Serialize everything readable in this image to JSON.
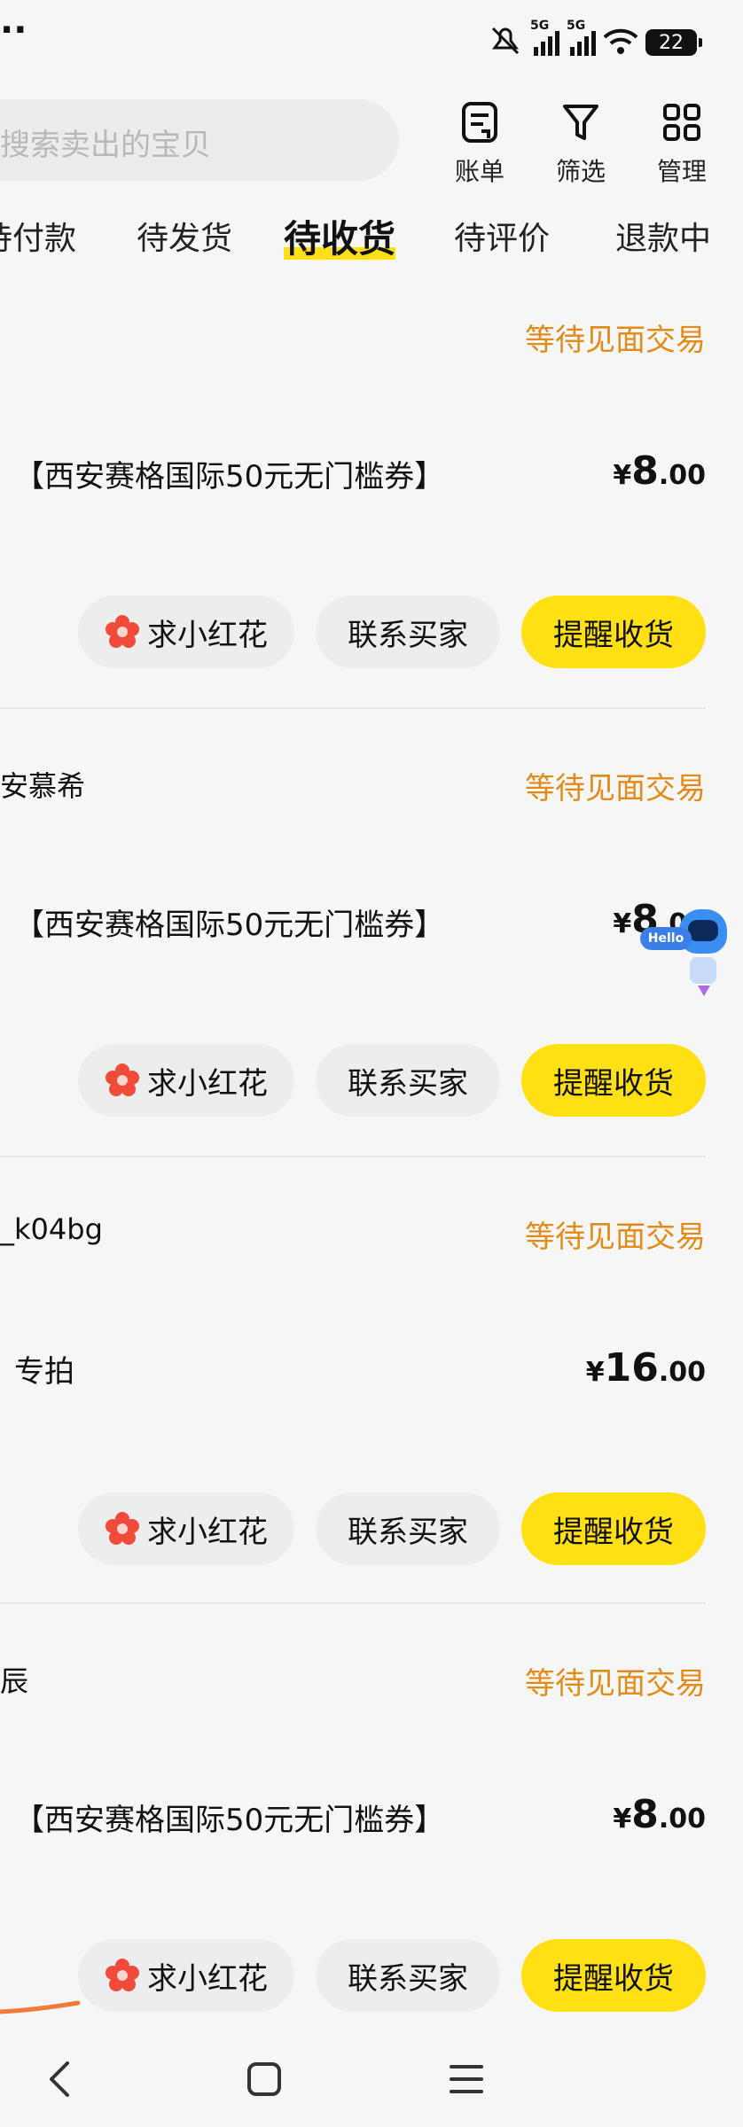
{
  "status_bar": {
    "dots": "··",
    "network_1": "5G",
    "network_2": "5G",
    "battery": "22"
  },
  "header": {
    "search_placeholder": "搜索卖出的宝贝",
    "tools": [
      {
        "label": "账单",
        "icon": "bill-icon"
      },
      {
        "label": "筛选",
        "icon": "filter-icon"
      },
      {
        "label": "管理",
        "icon": "grid-icon"
      }
    ]
  },
  "tabs": [
    {
      "label": "待付款",
      "active": false
    },
    {
      "label": "待发货",
      "active": false
    },
    {
      "label": "待收货",
      "active": true
    },
    {
      "label": "待评价",
      "active": false
    },
    {
      "label": "退款中",
      "active": false
    }
  ],
  "orders": [
    {
      "seller": "",
      "status": "等待见面交易",
      "title": "【西安赛格国际50元无门槛券】",
      "price_currency": "¥",
      "price_int": "8",
      "price_dec": ".00",
      "btn_flower": "求小红花",
      "btn_contact": "联系买家",
      "btn_remind": "提醒收货"
    },
    {
      "seller": "安慕希",
      "status": "等待见面交易",
      "title": "【西安赛格国际50元无门槛券】",
      "price_currency": "¥",
      "price_int": "8",
      "price_dec": ".00",
      "btn_flower": "求小红花",
      "btn_contact": "联系买家",
      "btn_remind": "提醒收货"
    },
    {
      "seller": "_k04bg",
      "status": "等待见面交易",
      "title": "专拍",
      "price_currency": "¥",
      "price_int": "16",
      "price_dec": ".00",
      "btn_flower": "求小红花",
      "btn_contact": "联系买家",
      "btn_remind": "提醒收货"
    },
    {
      "seller": "辰",
      "status": "等待见面交易",
      "title": "【西安赛格国际50元无门槛券】",
      "price_currency": "¥",
      "price_int": "8",
      "price_dec": ".00",
      "btn_flower": "求小红花",
      "btn_contact": "联系买家",
      "btn_remind": "提醒收货"
    }
  ],
  "assistant_bubble": "Hello",
  "colors": {
    "accent_yellow": "#ffe014",
    "status_orange": "#e08b1a",
    "flower_red": "#f04a3a"
  }
}
